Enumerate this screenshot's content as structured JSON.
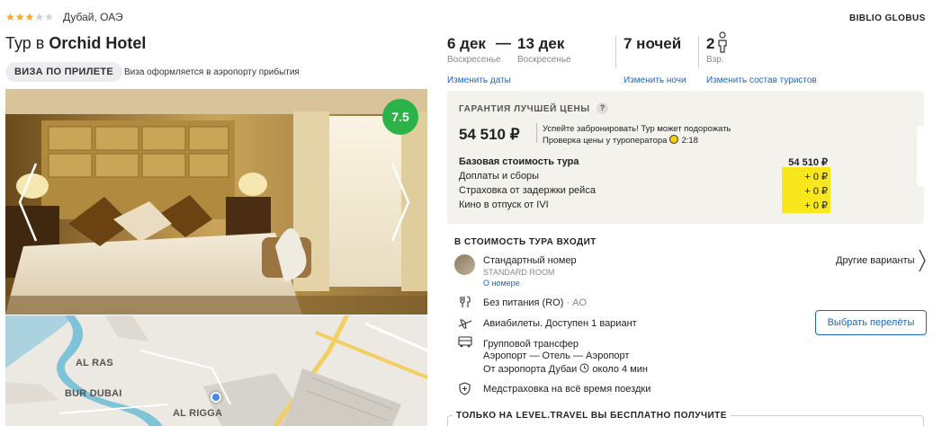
{
  "hotel": {
    "stars": 3,
    "location": "Дубай, ОАЭ",
    "title_prefix": "Тур в",
    "name": "Orchid Hotel",
    "visa_badge": "ВИЗА ПО ПРИЛЕТЕ",
    "visa_note": "Виза оформляется в аэропорту прибытия",
    "rating": "7.5"
  },
  "map": {
    "labels": [
      "AL RAS",
      "BUR DUBAI",
      "AL RIGGA"
    ]
  },
  "operator": "BIBLIO GLOBUS",
  "dates": {
    "from_date": "6 дек",
    "dash": "—",
    "to_date": "13 дек",
    "from_day": "Воскресенье",
    "to_day": "Воскресенье",
    "change_dates": "Изменить даты",
    "nights": "7 ночей",
    "change_nights": "Изменить ночи",
    "adults": "2",
    "adults_label": "Взр.",
    "change_tourists": "Изменить состав туристов"
  },
  "price": {
    "guarantee": "ГАРАНТИЯ ЛУЧШЕЙ ЦЕНЫ",
    "question": "?",
    "total": "54 510 ₽",
    "hurry_line1": "Успейте забронировать! Тур может подорожать",
    "hurry_line2": "Проверка цены у туроператора",
    "timer": "2:18",
    "rows": [
      {
        "label": "Базовая стоимость тура",
        "value": "54 510 ₽"
      },
      {
        "label": "Доплаты и сборы",
        "value": "+ 0 ₽"
      },
      {
        "label": "Страховка от задержки рейса",
        "value": "+ 0 ₽"
      },
      {
        "label": "Кино в отпуск от IVI",
        "value": "+ 0 ₽"
      }
    ]
  },
  "included": {
    "title": "В СТОИМОСТЬ ТУРА ВХОДИТ",
    "room_name": "Стандартный номер",
    "room_type": "STANDARD ROOM",
    "room_link": "О номере",
    "other_options": "Другие варианты",
    "meal": "Без питания (RO)",
    "meal_code": "· AO",
    "flights": "Авиабилеты. Доступен 1 вариант",
    "select_flights": "Выбрать перелёты",
    "transfer": "Групповой трансфер",
    "transfer_route": "Аэропорт — Отель — Аэропорт",
    "transfer_time_prefix": "От аэропорта Дубаи",
    "transfer_time": "около 4 мин",
    "insurance": "Медстраховка на всё время поездки"
  },
  "bonus": {
    "title": "ТОЛЬКО НА LEVEL.TRAVEL ВЫ БЕСПЛАТНО ПОЛУЧИТЕ"
  },
  "colors": {
    "accent_link": "#1a66c9",
    "rating_green": "#2bb34a",
    "highlight_yellow": "#f8e71c",
    "price_box_bg": "#f3f2ed"
  }
}
